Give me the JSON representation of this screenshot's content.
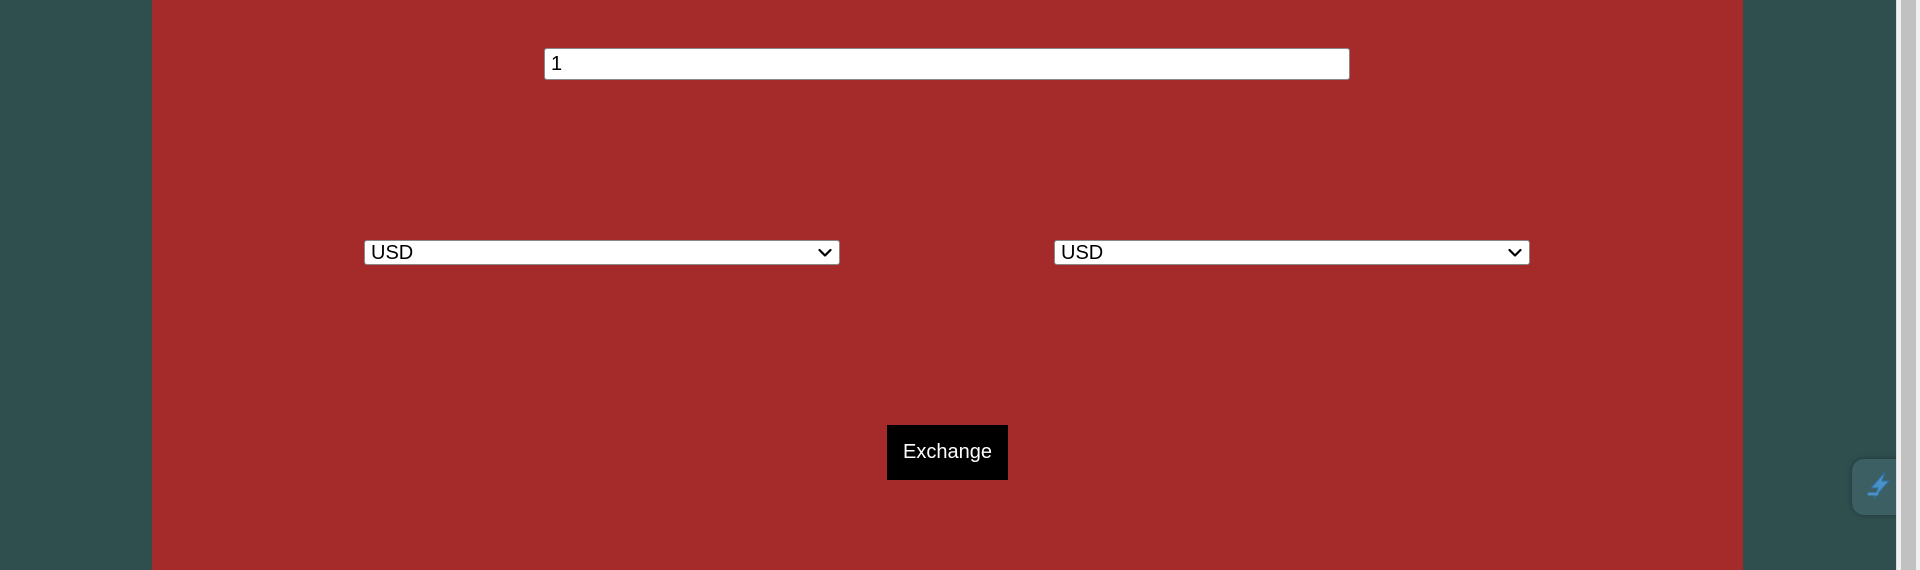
{
  "converter": {
    "amount_value": "1",
    "from_currency": "USD",
    "to_currency": "USD",
    "exchange_label": "Exchange"
  },
  "icons": {
    "dropdown": "chevron-down-icon",
    "widget": "lightning-icon"
  },
  "colors": {
    "background": "#2f4f4f",
    "panel": "#a52a2a",
    "button": "#000000",
    "button_text": "#ffffff"
  }
}
